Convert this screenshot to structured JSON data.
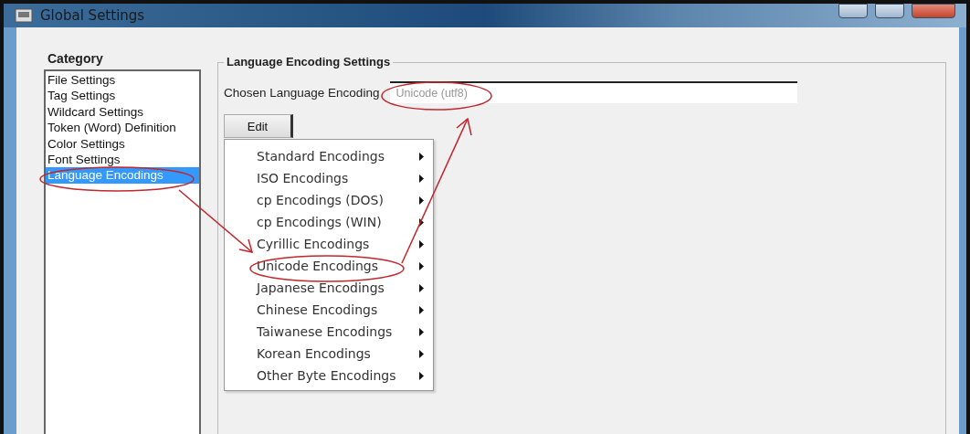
{
  "window": {
    "title": "Global Settings"
  },
  "category": {
    "label": "Category",
    "items": [
      {
        "label": "File Settings",
        "selected": false
      },
      {
        "label": "Tag Settings",
        "selected": false
      },
      {
        "label": "Wildcard Settings",
        "selected": false
      },
      {
        "label": "Token (Word) Definition",
        "selected": false
      },
      {
        "label": "Color Settings",
        "selected": false
      },
      {
        "label": "Font Settings",
        "selected": false
      },
      {
        "label": "Language Encodings",
        "selected": true
      }
    ]
  },
  "group": {
    "title": "Language Encoding Settings",
    "field_label": "Chosen Language Encoding",
    "field_value": "Unicode (utf8)",
    "edit_button": "Edit"
  },
  "menu": [
    {
      "label": "Standard Encodings",
      "submenu": true
    },
    {
      "label": "ISO Encodings",
      "submenu": true
    },
    {
      "label": "cp Encodings (DOS)",
      "submenu": true
    },
    {
      "label": "cp Encodings (WIN)",
      "submenu": true
    },
    {
      "label": "Cyrillic Encodings",
      "submenu": true
    },
    {
      "label": "Unicode Encodings",
      "submenu": true
    },
    {
      "label": "Japanese Encodings",
      "submenu": true
    },
    {
      "label": "Chinese Encodings",
      "submenu": true
    },
    {
      "label": "Taiwanese Encodings",
      "submenu": true
    },
    {
      "label": "Korean Encodings",
      "submenu": true
    },
    {
      "label": "Other Byte Encodings",
      "submenu": true
    }
  ]
}
